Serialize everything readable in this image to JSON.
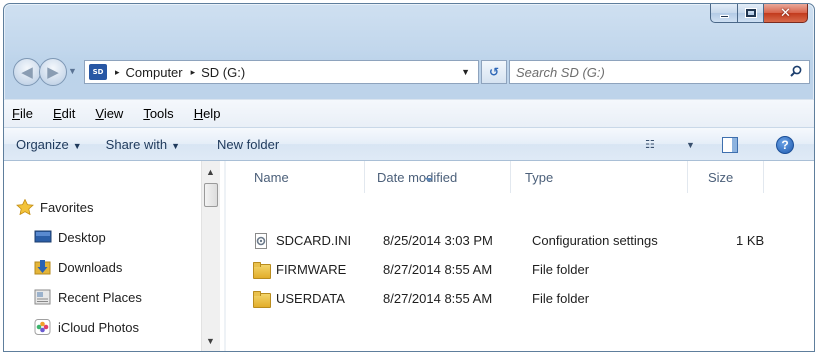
{
  "window": {
    "controls": {
      "minimize_icon": "minimize-icon",
      "maximize_icon": "maximize-icon",
      "close_glyph": "✕"
    }
  },
  "navigation": {
    "back_glyph": "◀",
    "forward_glyph": "▶",
    "address": {
      "drive_badge": "SD",
      "crumbs": [
        "Computer",
        "SD (G:)"
      ],
      "separator": "▸"
    },
    "refresh_glyph": "↺",
    "search": {
      "placeholder": "Search SD (G:)"
    }
  },
  "menubar": {
    "items": [
      {
        "mnemonic": "F",
        "rest": "ile"
      },
      {
        "mnemonic": "E",
        "rest": "dit"
      },
      {
        "mnemonic": "V",
        "rest": "iew"
      },
      {
        "mnemonic": "T",
        "rest": "ools"
      },
      {
        "mnemonic": "H",
        "rest": "elp"
      }
    ]
  },
  "commandbar": {
    "organize": "Organize",
    "share_with": "Share with",
    "new_folder": "New folder",
    "dropdown_glyph": "▼",
    "view_glyph": "☷",
    "help_glyph": "?"
  },
  "nav_pane": {
    "favorites": "Favorites",
    "items": [
      "Desktop",
      "Downloads",
      "Recent Places",
      "iCloud Photos"
    ],
    "scroll_up": "▲",
    "scroll_down": "▼"
  },
  "file_list": {
    "columns": [
      "Name",
      "Date modified",
      "Type",
      "Size"
    ],
    "rows": [
      {
        "name": "SDCARD.INI",
        "date": "8/25/2014 3:03 PM",
        "type": "Configuration settings",
        "size": "1 KB",
        "icon": "settings-file-icon"
      },
      {
        "name": "FIRMWARE",
        "date": "8/27/2014 8:55 AM",
        "type": "File folder",
        "size": "",
        "icon": "folder-icon"
      },
      {
        "name": "USERDATA",
        "date": "8/27/2014 8:55 AM",
        "type": "File folder",
        "size": "",
        "icon": "folder-icon"
      }
    ]
  },
  "colors": {
    "frame": "#bcd3ea",
    "close_button": "#c23a1d",
    "link_text": "#1e395b"
  }
}
